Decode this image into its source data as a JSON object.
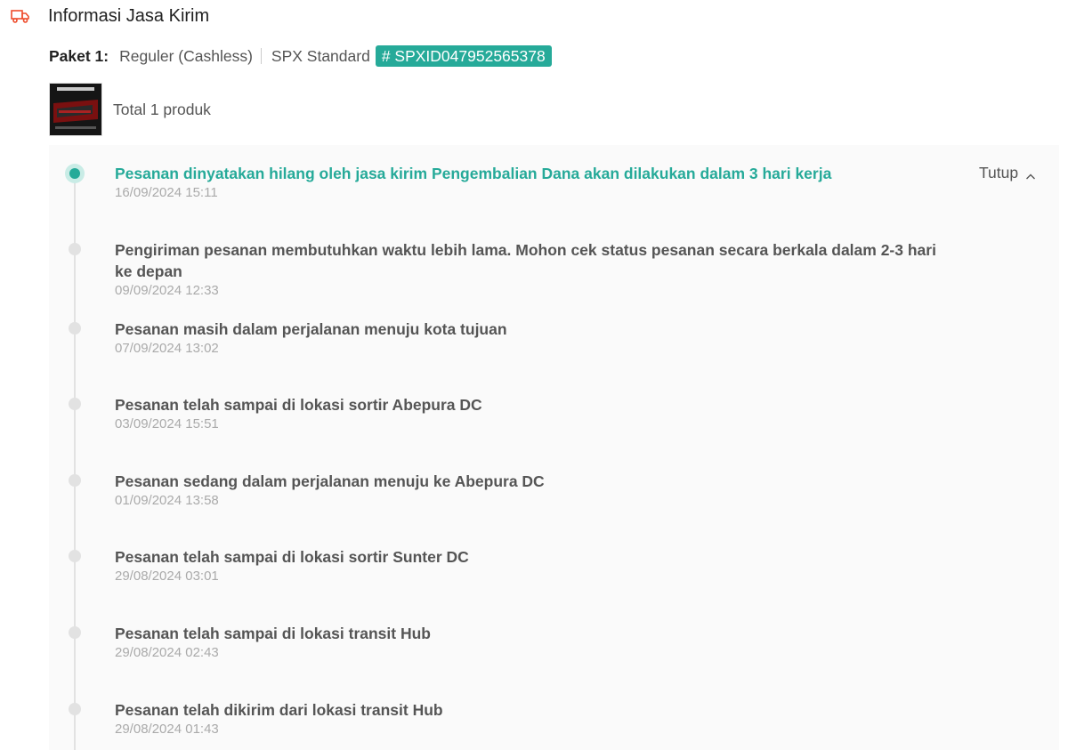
{
  "header": {
    "title": "Informasi Jasa Kirim",
    "icon": "truck-icon",
    "accent": "#ee4d2d"
  },
  "package": {
    "label": "Paket 1:",
    "service": "Reguler (Cashless)",
    "courier": "SPX Standard",
    "tracking": "# SPXID047952565378",
    "badge_color": "#26aa99"
  },
  "product": {
    "total": "Total 1 produk"
  },
  "timeline": {
    "toggle_label": "Tutup",
    "events": [
      {
        "desc": "Pesanan dinyatakan hilang oleh jasa kirim Pengembalian Dana akan dilakukan dalam 3 hari kerja",
        "time": "16/09/2024 15:11"
      },
      {
        "desc": "Pengiriman pesanan membutuhkan waktu lebih lama. Mohon cek status pesanan secara berkala dalam 2-3 hari ke depan",
        "time": "09/09/2024 12:33"
      },
      {
        "desc": "Pesanan masih dalam perjalanan menuju kota tujuan",
        "time": "07/09/2024 13:02"
      },
      {
        "desc": "Pesanan telah sampai di lokasi sortir Abepura DC",
        "time": "03/09/2024 15:51"
      },
      {
        "desc": "Pesanan sedang dalam perjalanan menuju ke Abepura DC",
        "time": "01/09/2024 13:58"
      },
      {
        "desc": "Pesanan telah sampai di lokasi sortir Sunter DC",
        "time": "29/08/2024 03:01"
      },
      {
        "desc": "Pesanan telah sampai di lokasi transit Hub",
        "time": "29/08/2024 02:43"
      },
      {
        "desc": "Pesanan telah dikirim dari lokasi transit Hub",
        "time": "29/08/2024 01:43"
      }
    ]
  }
}
